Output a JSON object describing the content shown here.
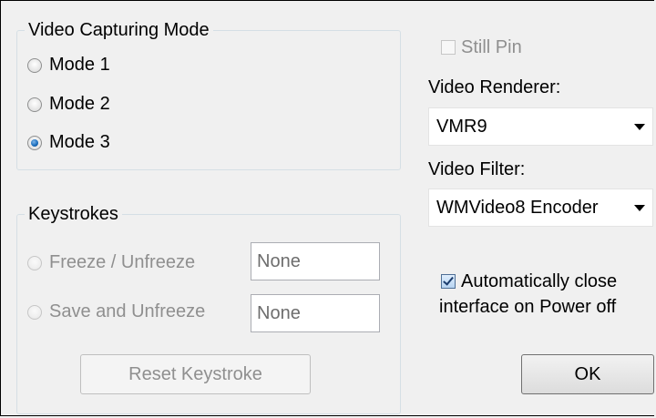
{
  "video_mode": {
    "title": "Video Capturing Mode",
    "options": [
      "Mode 1",
      "Mode 2",
      "Mode 3"
    ],
    "selected": "Mode 3"
  },
  "keystrokes": {
    "title": "Keystrokes",
    "freeze_label": "Freeze / Unfreeze",
    "freeze_value": "None",
    "save_label": "Save and Unfreeze",
    "save_value": "None",
    "reset_label": "Reset  Keystroke"
  },
  "still_pin": {
    "label": "Still Pin",
    "checked": false,
    "enabled": false
  },
  "video_renderer": {
    "label": "Video Renderer:",
    "value": "VMR9"
  },
  "video_filter": {
    "label": "Video Filter:",
    "value": "WMVideo8 Encoder"
  },
  "auto_close": {
    "label_line1": "Automatically close",
    "label_line2": "interface on Power off",
    "checked": true
  },
  "ok_button": {
    "label": "OK"
  },
  "colors": {
    "background": "#f0f0f0",
    "disabled_text": "#8f8f8f",
    "radio_selected": "#1c6fbf"
  }
}
